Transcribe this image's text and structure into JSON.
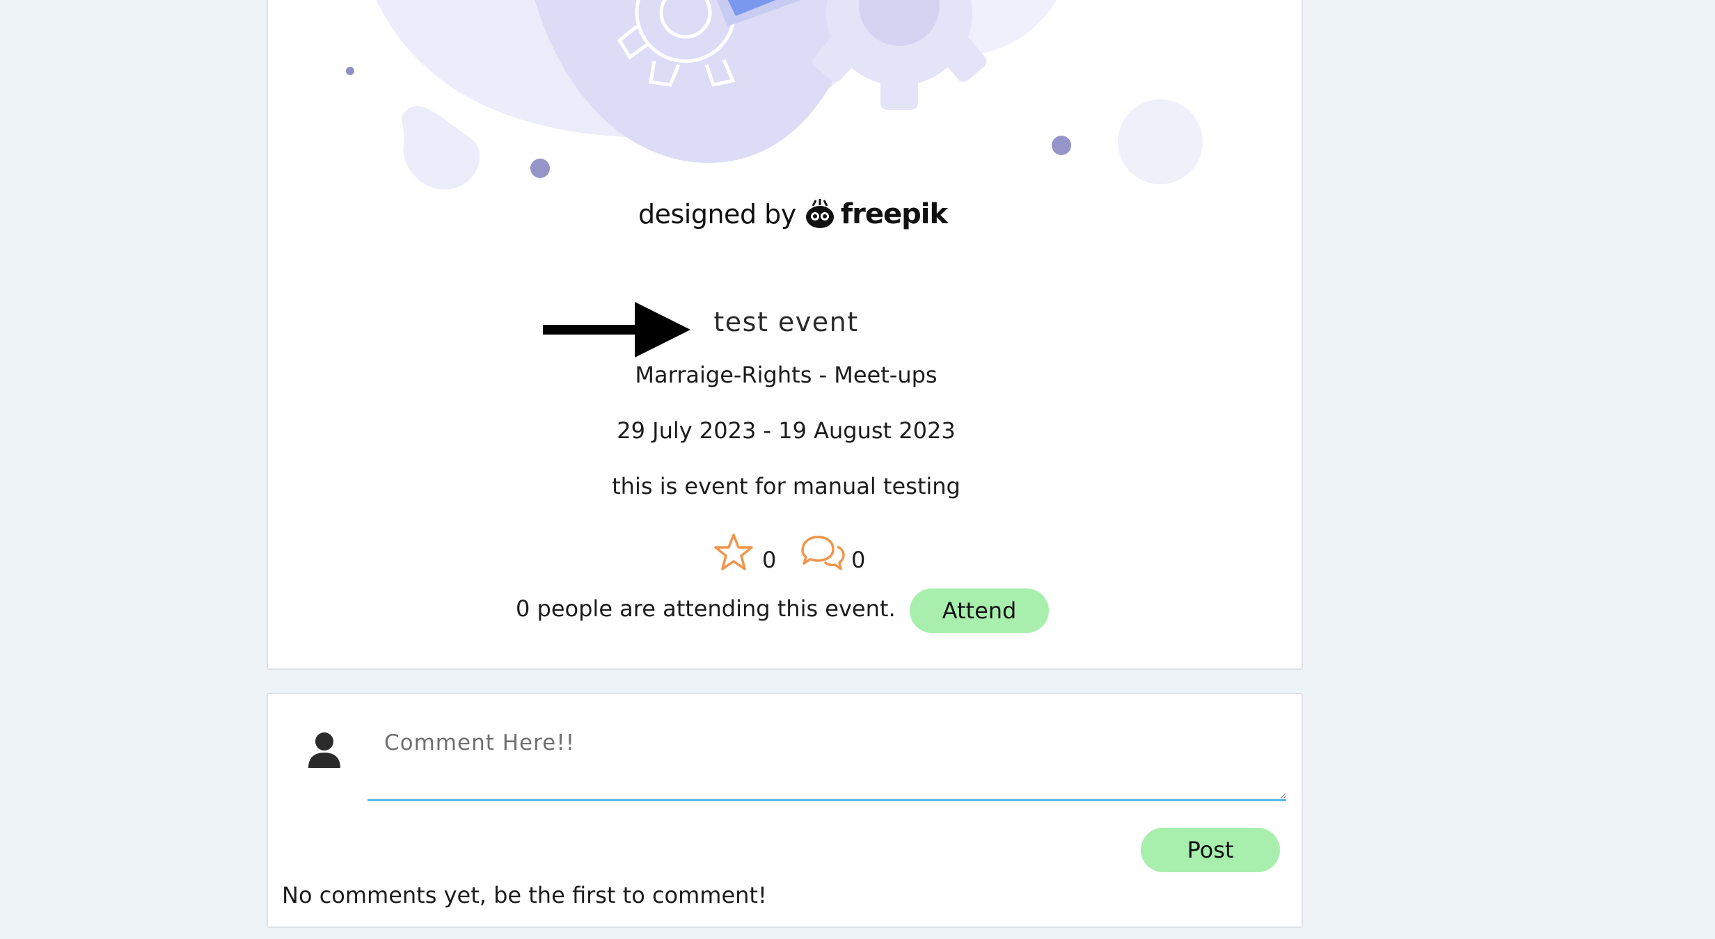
{
  "credit": {
    "prefix": "designed by",
    "brand": "freepik"
  },
  "event": {
    "title": "test event",
    "category": "Marraige-Rights - Meet-ups",
    "dates": "29 July 2023 - 19 August 2023",
    "description": "this is event for manual testing",
    "likes": "0",
    "comments_count": "0",
    "attending_text": "0 people are attending this event.",
    "attend_label": "Attend"
  },
  "comment_form": {
    "placeholder": "Comment Here!!",
    "value": "",
    "post_label": "Post",
    "empty_message": "No comments yet, be the first to comment!"
  },
  "colors": {
    "page_bg": "#eef3f8",
    "accent_orange": "#f0954b",
    "button_green": "#a8efae",
    "input_underline": "#5cb8e8",
    "illustration_purple": "#8e8fc8"
  },
  "icons": {
    "arrow": "right-arrow-icon",
    "like": "star-icon",
    "comments": "chat-bubbles-icon",
    "avatar": "user-avatar-icon",
    "brand": "freepik-logo-icon"
  }
}
